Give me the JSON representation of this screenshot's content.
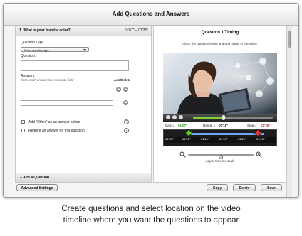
{
  "window": {
    "title": "Add Questions and Answers"
  },
  "question_panel": {
    "header": "1. What is your favorite color?",
    "time_range": "01'07\" – 01'25\"",
    "question_type_label": "Question Type",
    "question_type_value": "Select question type",
    "question_label": "Question:",
    "question_value": "",
    "answers_label": "Answers:",
    "answers_hint": "Enter each answer in a separate field",
    "add_delete_label": "Add/Delete",
    "answers": [
      "",
      ""
    ],
    "options": [
      {
        "label": "Add \"Other\" as an answer option",
        "checked": false
      },
      {
        "label": "Require an answer for this question",
        "checked": false
      }
    ],
    "help_glyph": "?",
    "add_question": "+ Add a Question"
  },
  "timing_panel": {
    "title": "Question 1 Timing",
    "instruction": "Place the question begin and end points in the video:",
    "playback_progress": 0.38,
    "start_label": "Start =",
    "start_value": "01'07\"",
    "range_label": "Range =",
    "range_value": "00'18\"",
    "stop_label": "Stop =",
    "stop_value": "01'25\"",
    "timeline_labels": [
      "00'55\"",
      "01'05\"",
      "01'10\"",
      "01'15\"",
      "01'20\"",
      "01'25\""
    ],
    "zoom_level": 0.5,
    "zoom_caption": "Adjust timeline scale",
    "colors": {
      "start_marker": "#5ccf2a",
      "stop_marker": "#e03a3a",
      "range_band": "#6ea6ff"
    },
    "icons": [
      "rewind-icon",
      "play-icon",
      "forward-icon",
      "zoom-out-icon",
      "zoom-in-icon"
    ]
  },
  "footer": {
    "advanced": "Advanced Settings",
    "copy": "Copy",
    "delete": "Delete",
    "save": "Save"
  },
  "caption": {
    "line1": "Create questions and select location on the video",
    "line2": "timeline where you want the questions to appear"
  }
}
